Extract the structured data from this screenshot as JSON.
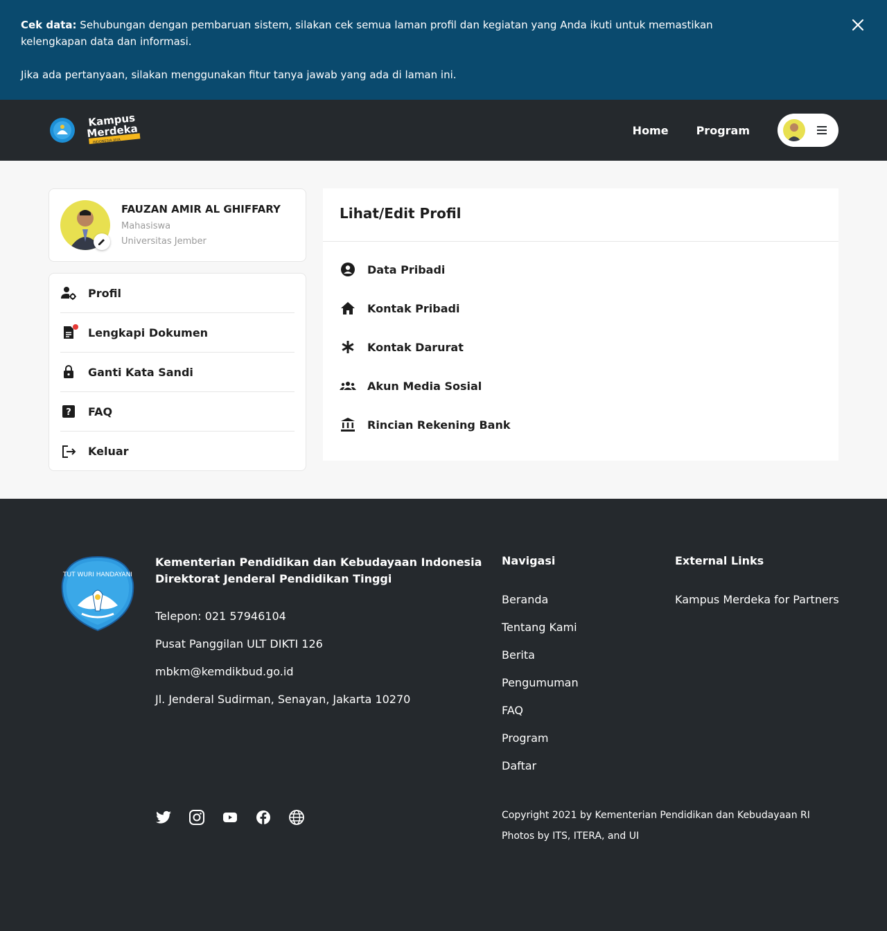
{
  "banner": {
    "bold_prefix": "Cek data:",
    "line1": " Sehubungan dengan pembaruan sistem, silakan cek semua laman profil dan kegiatan yang Anda ikuti untuk memastikan kelengkapan data dan informasi.",
    "line2": "Jika ada pertanyaan, silakan menggunakan fitur tanya jawab yang ada di laman ini.",
    "close_icon": "close-icon"
  },
  "header": {
    "logo_text": "Kampus Merdeka",
    "logo_sub": "INDONESIA JAYA",
    "nav": [
      {
        "label": "Home"
      },
      {
        "label": "Program"
      }
    ],
    "menu_icon": "hamburger-icon"
  },
  "profile": {
    "name": "FAUZAN AMIR AL GHIFFARY",
    "role": "Mahasiswa",
    "university": "Universitas Jember"
  },
  "sidebar": {
    "items": [
      {
        "label": "Profil",
        "icon": "user-settings-icon"
      },
      {
        "label": "Lengkapi Dokumen",
        "icon": "document-icon"
      },
      {
        "label": "Ganti Kata Sandi",
        "icon": "lock-icon"
      },
      {
        "label": "FAQ",
        "icon": "help-icon"
      },
      {
        "label": "Keluar",
        "icon": "logout-icon"
      }
    ]
  },
  "panel": {
    "title": "Lihat/Edit Profil",
    "items": [
      {
        "label": "Data Pribadi",
        "icon": "account-circle-icon"
      },
      {
        "label": "Kontak Pribadi",
        "icon": "home-icon"
      },
      {
        "label": "Kontak Darurat",
        "icon": "asterisk-icon"
      },
      {
        "label": "Akun Media Sosial",
        "icon": "group-icon"
      },
      {
        "label": "Rincian Rekening Bank",
        "icon": "bank-icon"
      }
    ]
  },
  "footer": {
    "org_line1": "Kementerian Pendidikan dan Kebudayaan Indonesia",
    "org_line2": "Direktorat Jenderal Pendidikan Tinggi",
    "contact": [
      "Telepon: 021 57946104",
      "Pusat Panggilan ULT DIKTI 126",
      "mbkm@kemdikbud.go.id",
      "Jl. Jenderal Sudirman, Senayan, Jakarta 10270"
    ],
    "nav_title": "Navigasi",
    "nav": [
      "Beranda",
      "Tentang Kami",
      "Berita",
      "Pengumuman",
      "FAQ",
      "Program",
      "Daftar"
    ],
    "ext_title": "External Links",
    "ext": [
      "Kampus Merdeka for Partners"
    ],
    "copyright": "Copyright 2021 by Kementerian Pendidikan dan Kebudayaan RI",
    "photos": "Photos by ITS, ITERA, and UI",
    "social": [
      "twitter-icon",
      "instagram-icon",
      "youtube-icon",
      "facebook-icon",
      "globe-icon"
    ],
    "seal_motto": "TUT WURI HANDAYANI"
  },
  "colors": {
    "banner_bg": "#0a4a6e",
    "header_bg": "#25292d",
    "footer_bg": "#25292d",
    "notification_dot": "#e53935"
  }
}
